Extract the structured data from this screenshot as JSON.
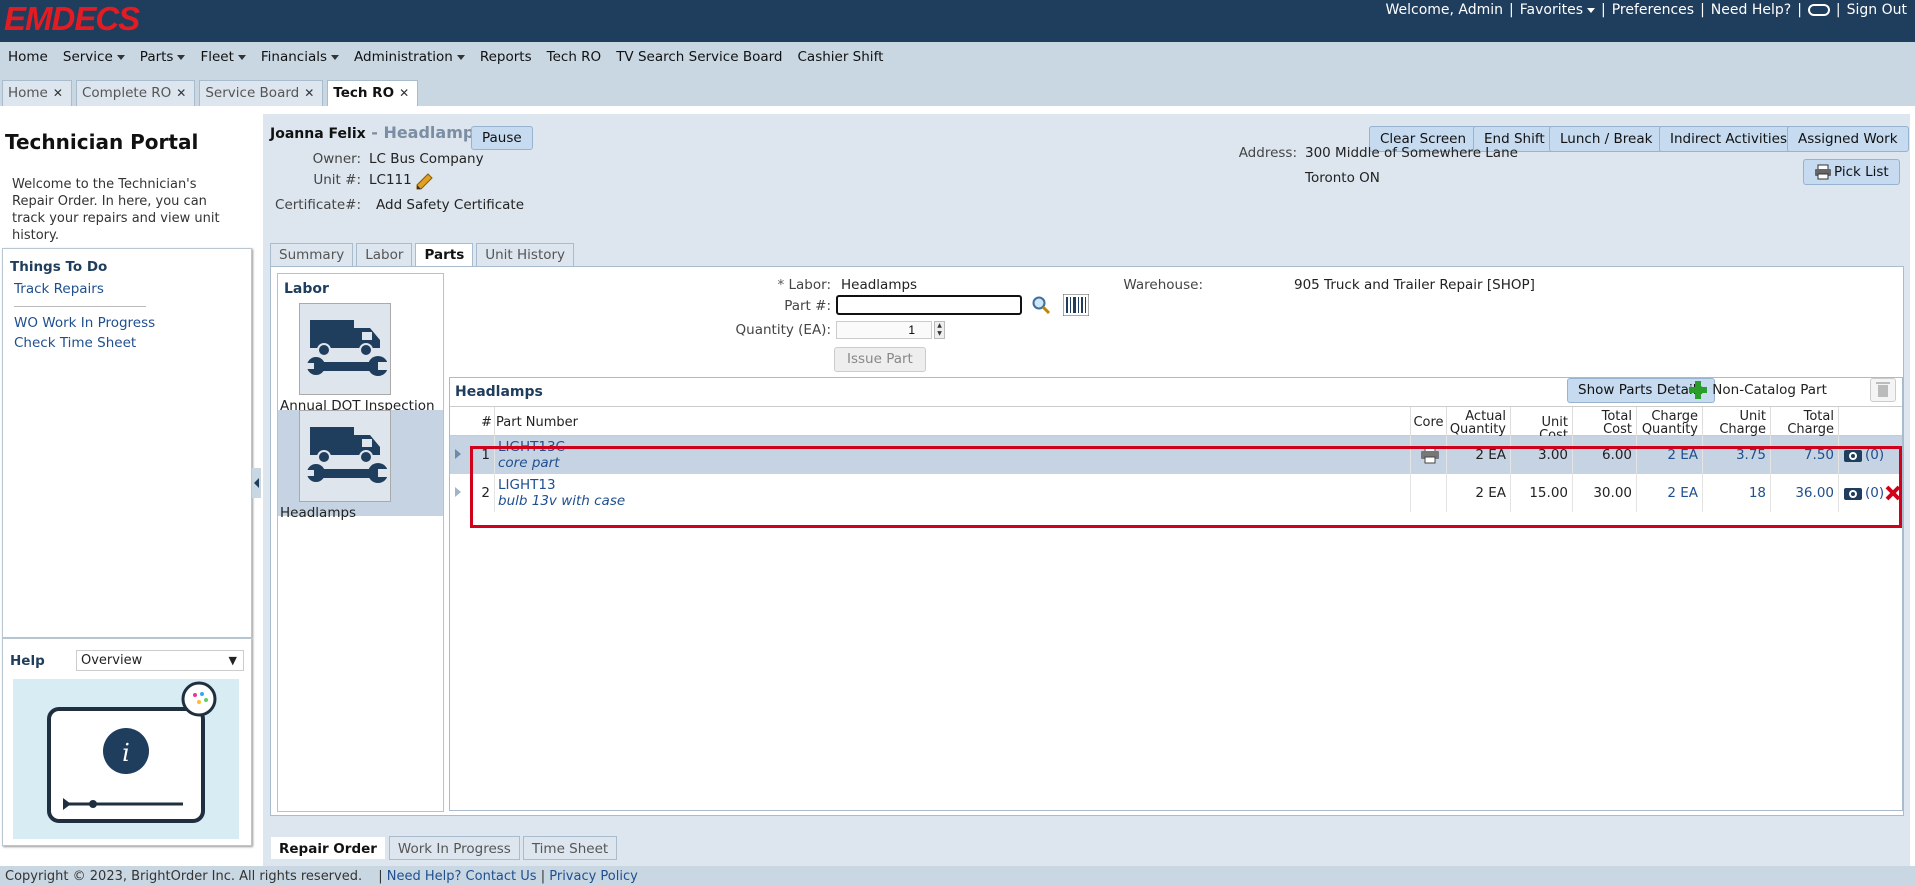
{
  "header": {
    "logo": "EMDECS",
    "welcome": "Welcome, Admin",
    "favorites": "Favorites",
    "preferences": "Preferences",
    "need_help": "Need Help?",
    "sign_out": "Sign Out",
    "sep": "|"
  },
  "nav": {
    "home": "Home",
    "service": "Service",
    "parts": "Parts",
    "fleet": "Fleet",
    "financials": "Financials",
    "administration": "Administration",
    "reports": "Reports",
    "tech_ro": "Tech RO",
    "tv_search": "TV Search Service Board",
    "cashier_shift": "Cashier Shift"
  },
  "page_tabs": [
    {
      "label": "Home",
      "active": false
    },
    {
      "label": "Complete RO",
      "active": false
    },
    {
      "label": "Service Board",
      "active": false
    },
    {
      "label": "Tech RO",
      "active": true
    }
  ],
  "sidebar": {
    "title": "Technician Portal",
    "welcome": "Welcome to the Technician's Repair Order. In here, you can track your repairs and view unit history.",
    "todo_title": "Things To Do",
    "links": [
      "Track Repairs",
      "WO Work In Progress",
      "Check Time Sheet"
    ],
    "help_title": "Help",
    "help_option": "Overview"
  },
  "tech": {
    "name": "Joanna Felix",
    "dash": " - ",
    "job": "Headlamps",
    "pause": "Pause"
  },
  "toolbar": {
    "clear_screen": "Clear Screen",
    "end_shift": "End Shift",
    "lunch_break": "Lunch / Break",
    "indirect": "Indirect Activities",
    "assigned": "Assigned Work",
    "pick_list": "Pick List"
  },
  "info": {
    "owner_label": "Owner:",
    "owner": "LC Bus Company",
    "unit_label": "Unit #:",
    "unit": "LC111",
    "cert_label": "Certificate#:",
    "cert": "Add Safety Certificate",
    "address_label": "Address:",
    "address1": "300 Middle of Somewhere Lane",
    "address2": "Toronto ON"
  },
  "subtabs": [
    "Summary",
    "Labor",
    "Parts",
    "Unit History"
  ],
  "labor_list": {
    "title": "Labor",
    "items": [
      {
        "label": "Annual DOT Inspection"
      },
      {
        "label": "Headlamps"
      }
    ]
  },
  "form": {
    "req": "*",
    "labor_label": "Labor:",
    "labor_value": "Headlamps",
    "part_label": "Part #:",
    "part_value": "",
    "qty_label": "Quantity (EA):",
    "qty_value": "1",
    "issue_btn": "Issue Part",
    "warehouse_label": "Warehouse:",
    "warehouse": "905 Truck and Trailer Repair [SHOP]"
  },
  "grid": {
    "title": "Headlamps",
    "show_details": "Show Parts Details",
    "non_catalog": "Non-Catalog Part",
    "columns": {
      "num": "#",
      "part": "Part Number",
      "core": "Core",
      "actual_qty": "Actual Quantity",
      "unit_cost": "Unit Cost",
      "total_cost": "Total Cost",
      "charge_qty": "Charge Quantity",
      "unit_charge": "Unit Charge",
      "total_charge": "Total Charge"
    },
    "rows": [
      {
        "num": "1",
        "part": "LIGHT13C",
        "desc": "core part",
        "actual_qty": "2 EA",
        "unit_cost": "3.00",
        "total_cost": "6.00",
        "charge_qty": "2 EA",
        "unit_charge": "3.75",
        "total_charge": "7.50",
        "photos": "(0)"
      },
      {
        "num": "2",
        "part": "LIGHT13",
        "desc": "bulb 13v with case",
        "actual_qty": "2 EA",
        "unit_cost": "15.00",
        "total_cost": "30.00",
        "charge_qty": "2 EA",
        "unit_charge": "18",
        "total_charge": "36.00",
        "photos": "(0)"
      }
    ]
  },
  "bottom_tabs": [
    "Repair Order",
    "Work In Progress",
    "Time Sheet"
  ],
  "footer": {
    "copyright": "Copyright © 2023, BrightOrder Inc. All rights reserved.",
    "help_link": "Need Help? Contact Us",
    "privacy": "Privacy Policy"
  },
  "colors": {
    "header_bg": "#1f3d5c",
    "logo": "#e31c23",
    "highlight": "#d0021b",
    "selected_row": "#c5d3e3"
  }
}
